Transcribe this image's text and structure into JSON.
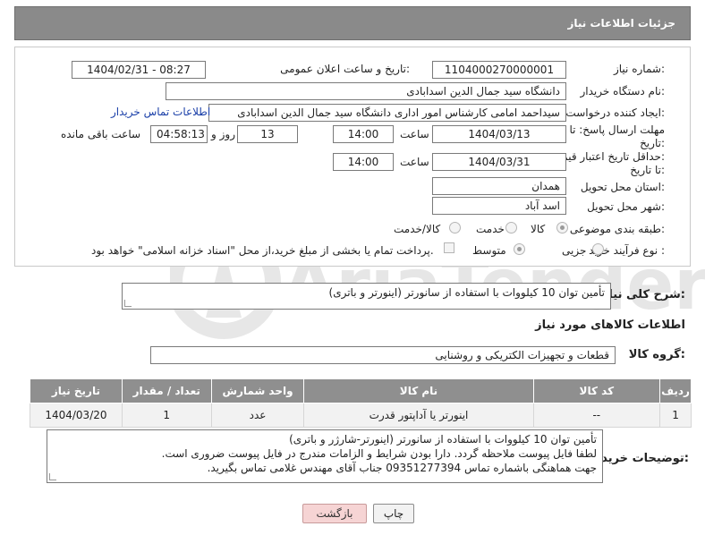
{
  "header": {
    "title": "جزئیات اطلاعات نیاز"
  },
  "form": {
    "need_number_label": "شماره نیاز:",
    "need_number_value": "1104000270000001",
    "announce_label": "تاریخ و ساعت اعلان عمومی:",
    "announce_value": "1404/02/31 - 08:27",
    "buyer_org_label": "نام دستگاه خریدار:",
    "buyer_org_value": "دانشگاه سید جمال الدین اسدابادی",
    "requester_label": "ایجاد کننده درخواست:",
    "requester_value": "سیداحمد امامی کارشناس امور اداری دانشگاه سید جمال الدین اسدابادی",
    "buyer_contact_link": "اطلاعات تماس خریدار",
    "deadline_label_1": "مهلت ارسال پاسخ: تا",
    "deadline_label_2": "تاریخ:",
    "deadline_date": "1404/03/13",
    "time_label": "ساعت",
    "deadline_time": "14:00",
    "days_value": "13",
    "days_label": "روز و",
    "remaining_time": "04:58:13",
    "remaining_label": "ساعت باقی مانده",
    "price_validity_label_1": "حداقل تاریخ اعتبار قیمت:",
    "price_validity_label_2": "تا تاریخ:",
    "price_validity_date": "1404/03/31",
    "price_validity_time": "14:00",
    "province_label": "استان محل تحویل:",
    "province_value": "همدان",
    "city_label": "شهر محل تحویل:",
    "city_value": "اسد آباد",
    "category_label": "طبقه بندی موضوعی:",
    "category_options": [
      "کالا",
      "خدمت",
      "کالا/خدمت"
    ],
    "category_selected": "کالا",
    "process_label": "نوع فرآیند خرید :",
    "process_options": [
      "جزیی",
      "متوسط"
    ],
    "process_selected": "متوسط",
    "payment_note": "پرداخت تمام یا بخشی از مبلغ خرید،از محل \"اسناد خزانه اسلامی\" خواهد بود."
  },
  "description": {
    "label": "شرح کلی نیاز:",
    "value": "تأمین توان 10 کیلووات با استفاده از سانورتر (اینورتر و باتری)"
  },
  "goods_section": {
    "title": "اطلاعات کالاهای مورد نیاز",
    "group_label": "گروه کالا:",
    "group_value": "قطعات و تجهیزات الکتریکی و روشنایی"
  },
  "table": {
    "headers": [
      "ردیف",
      "کد کالا",
      "نام کالا",
      "واحد شمارش",
      "تعداد / مقدار",
      "تاریخ نیاز"
    ],
    "rows": [
      [
        "1",
        "--",
        "اینورتر یا آداپتور قدرت",
        "عدد",
        "1",
        "1404/03/20"
      ]
    ]
  },
  "buyer_notes": {
    "label": "توضیحات خریدار:",
    "lines": [
      "تأمین توان 10 کیلووات با استفاده از سانورتر (اینورتر-شارژر و باتری)",
      "لطفا فایل پیوست ملاحظه گردد. دارا بودن شرایط و الزامات مندرج در فایل پیوست ضروری است.",
      "جهت هماهنگی باشماره تماس 09351277394 جناب آقای مهندس غلامی تماس بگیرید."
    ]
  },
  "buttons": {
    "back": "بازگشت",
    "print": "چاپ"
  },
  "watermark": {
    "text": "AriaTender.neT"
  },
  "colors": {
    "header_bg": "#8a8a8a",
    "link": "#1a3fa8",
    "back_button": "#f6d4d4"
  }
}
